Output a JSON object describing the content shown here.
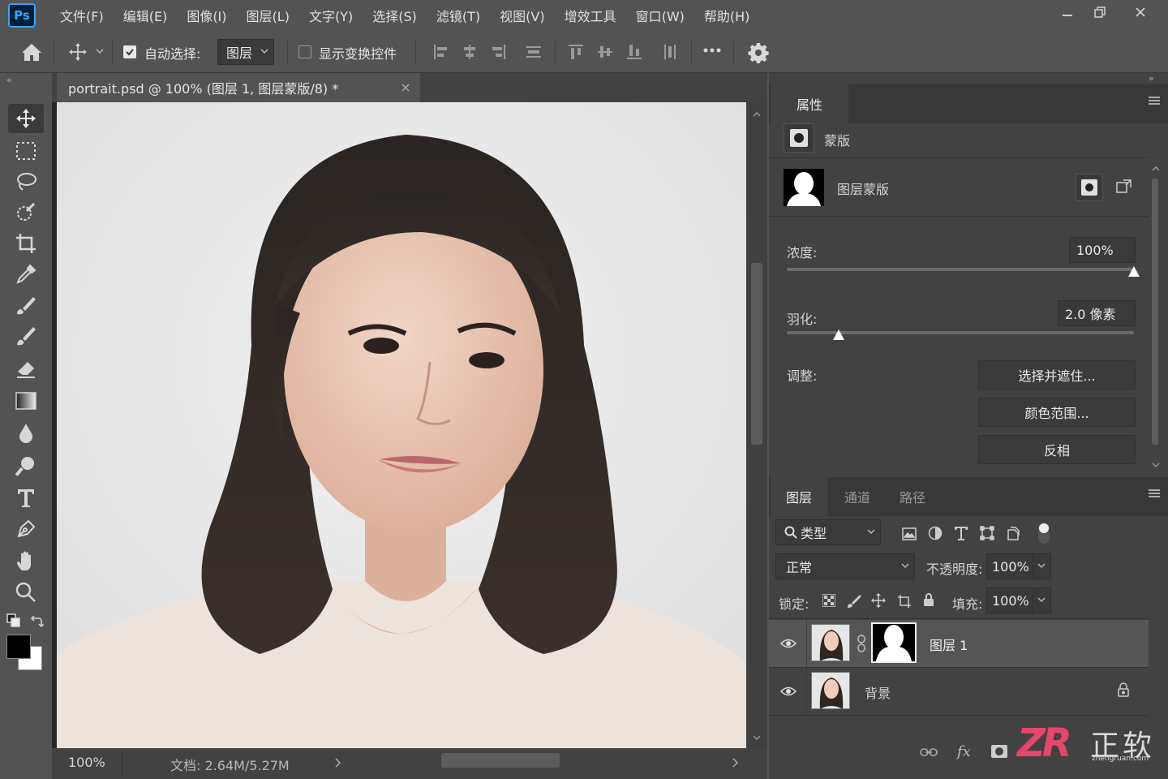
{
  "app": {
    "logo": "Ps"
  },
  "menu": [
    "文件(F)",
    "编辑(E)",
    "图像(I)",
    "图层(L)",
    "文字(Y)",
    "选择(S)",
    "滤镜(T)",
    "视图(V)",
    "增效工具",
    "窗口(W)",
    "帮助(H)"
  ],
  "options": {
    "auto_select_label": "自动选择:",
    "auto_select_checked": true,
    "auto_select_value": "图层",
    "show_transform_label": "显示变换控件",
    "show_transform_checked": false
  },
  "document": {
    "tab_title": "portrait.psd @ 100% (图层 1, 图层蒙版/8) *",
    "zoom": "100%",
    "doc_info": "文档: 2.64M/5.27M"
  },
  "properties": {
    "panel_title": "属性",
    "type_label": "蒙版",
    "mask_label": "图层蒙版",
    "density_label": "浓度:",
    "density_value": "100%",
    "density_level": 1.0,
    "feather_label": "羽化:",
    "feather_value": "2.0 像素",
    "feather_level": 0.15,
    "adjust_label": "调整:",
    "buttons": [
      "选择并遮住...",
      "颜色范围...",
      "反相"
    ]
  },
  "layers_panel": {
    "tabs": [
      "图层",
      "通道",
      "路径"
    ],
    "active_tab": 0,
    "filter_label": "类型",
    "blend_mode": "正常",
    "opacity_label": "不透明度:",
    "opacity_value": "100%",
    "lock_label": "锁定:",
    "fill_label": "填充:",
    "fill_value": "100%",
    "layers": [
      {
        "name": "图层 1",
        "visible": true,
        "selected": true,
        "has_mask": true
      },
      {
        "name": "背景",
        "visible": true,
        "selected": false,
        "locked": true
      }
    ]
  },
  "watermark": {
    "text": "正软",
    "sub": "zhengruan.com",
    "logo": "ZR"
  },
  "colors": {
    "accent": "#31a8ff",
    "panel": "#424242",
    "dark": "#383838",
    "watermark": "#e8456b"
  }
}
